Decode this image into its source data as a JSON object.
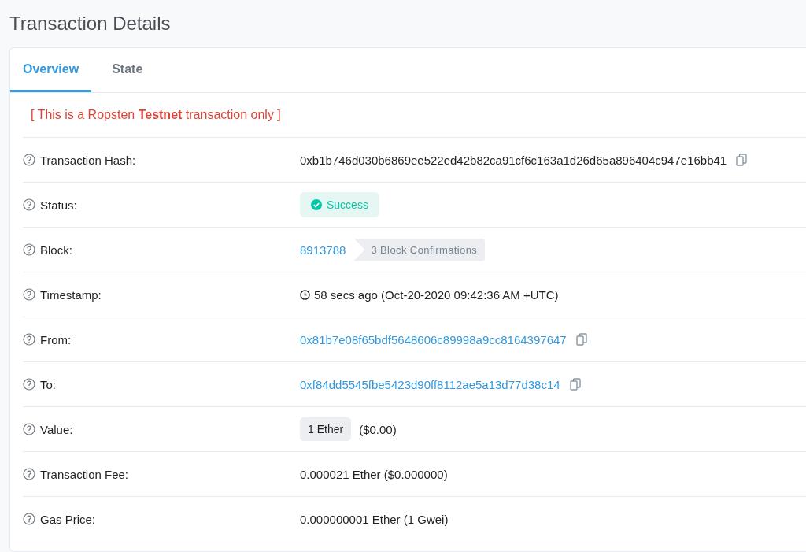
{
  "page": {
    "title": "Transaction Details"
  },
  "tabs": [
    {
      "label": "Overview",
      "selected": true
    },
    {
      "label": "State",
      "selected": false
    }
  ],
  "notice": "[ This is a Ropsten **Testnet** transaction only ]",
  "rows": [
    {
      "kind": "text",
      "label": "Transaction Hash:",
      "value": "0xb1b746d030b6869ee522ed42b82ca91cf6c163a1d26d65a896404c947e16bb41",
      "copy": true
    },
    {
      "kind": "status",
      "label": "Status:",
      "value": "Success"
    },
    {
      "kind": "block",
      "label": "Block:",
      "value": "8913788",
      "badge": "3 Block Confirmations"
    },
    {
      "kind": "timestamp",
      "label": "Timestamp:",
      "value": "58 secs ago (Oct-20-2020 09:42:36 AM +UTC)"
    },
    {
      "kind": "link",
      "label": "From:",
      "value": "0x81b7e08f65bdf5648606c89998a9cc8164397647",
      "copy": true
    },
    {
      "kind": "link",
      "label": "To:",
      "value": "0xf84dd5545fbe5423d90ff8112ae5a13d77d38c14",
      "copy": true
    },
    {
      "kind": "amount",
      "label": "Value:",
      "value": "1 Ether",
      "note": "($0.00)"
    },
    {
      "kind": "text",
      "label": "Transaction Fee:",
      "value": "0.000021 Ether ($0.000000)",
      "copy": false
    },
    {
      "kind": "text",
      "label": "Gas Price:",
      "value": "0.000000001 Ether (1 Gwei)",
      "copy": false
    }
  ]
}
